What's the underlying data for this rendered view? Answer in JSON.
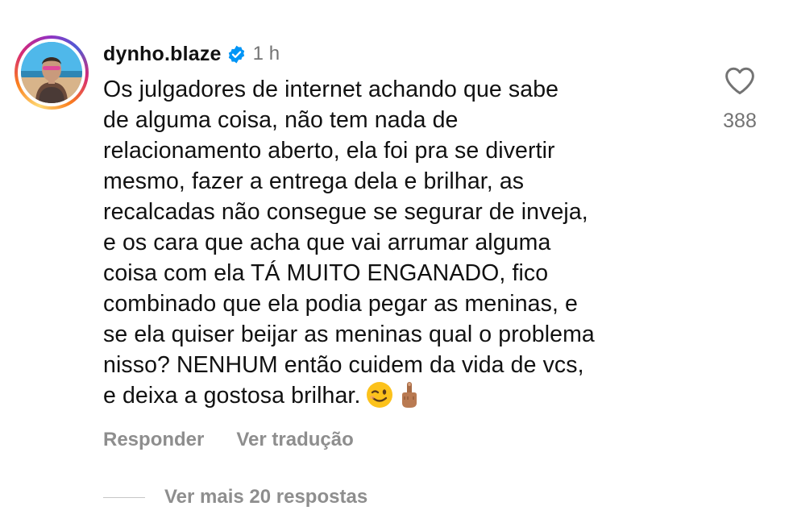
{
  "comment": {
    "username": "dynho.blaze",
    "verified_icon": "verified-badge-icon",
    "timestamp": "1 h",
    "text": "Os julgadores de internet achando que sabe\nde alguma coisa, não tem nada de\nrelacionamento aberto, ela foi pra se divertir\nmesmo, fazer a entrega dela e brilhar, as\nrecalcadas não consegue se segurar de inveja,\ne os cara que acha que vai arrumar alguma\ncoisa com ela TÁ MUITO ENGANADO, fico\ncombinado que ela podia pegar as meninas, e\nse ela quiser beijar as meninas qual o problema\nnisso? NENHUM então cuidem da vida de vcs,\ne deixa a gostosa brilhar.",
    "emojis": [
      "😉",
      "🖕🏽"
    ],
    "like_count": "388",
    "actions": {
      "reply_label": "Responder",
      "translate_label": "Ver tradução"
    },
    "view_replies_label": "Ver mais 20 respostas"
  },
  "colors": {
    "verified_blue": "#0095f6",
    "secondary_text": "#737373",
    "action_text": "#8e8e8e"
  },
  "icons": {
    "like": "heart-outline-icon",
    "verified": "verified-badge-icon"
  }
}
